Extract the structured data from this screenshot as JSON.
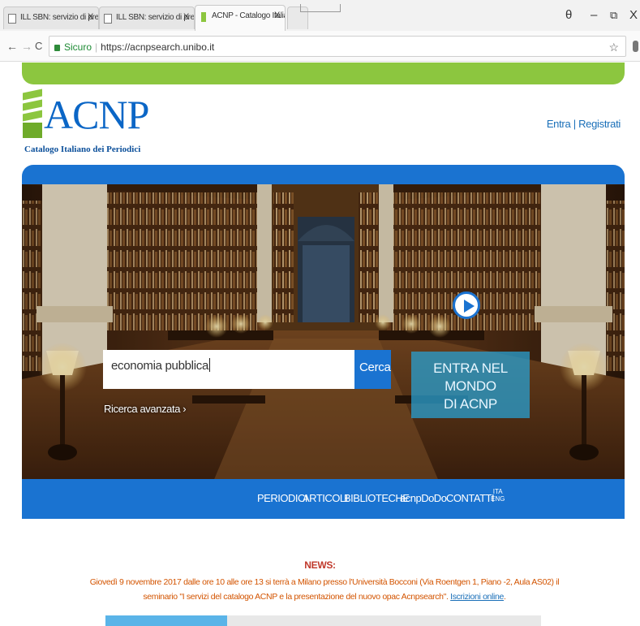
{
  "browser": {
    "tabs": [
      {
        "title": "ILL SBN: servizio di prest",
        "close": "X"
      },
      {
        "title": "ILL SBN: servizio di prest",
        "close": "X"
      },
      {
        "title": "ACNP - Catalogo Italiano",
        "close": "X"
      }
    ],
    "window_controls": {
      "user": "θ",
      "minimize": "–",
      "restore": "⧉",
      "close": "X"
    },
    "nav": {
      "back": "←",
      "forward": "→",
      "reload": "C"
    },
    "address": {
      "secure_label": "Sicuro",
      "url": "https://acnpsearch.unibo.it"
    },
    "bookmark_icon": "☆"
  },
  "header": {
    "logo_text": "ACNP",
    "logo_subtitle": "Catalogo Italiano dei Periodici",
    "login_link": "Entra | Registrati"
  },
  "search": {
    "query": "economia pubblica",
    "button_label": "Cerca",
    "advanced_link": "Ricerca avanzata ›"
  },
  "promo": {
    "line1": "ENTRA NEL MONDO",
    "line2": "DI ACNP"
  },
  "menu": {
    "items": [
      "PERIODICI",
      "ARTICOLI",
      "BIBLIOTECHE",
      "acnpDoDo",
      "CONTATTI"
    ],
    "lang_ita": "ITA",
    "lang_eng": "ENG"
  },
  "news": {
    "title": "NEWS:",
    "text": "Giovedì 9 novembre 2017 dalle ore 10 alle ore 13 si terrà a Milano presso l'Università Bocconi (Via Roentgen 1, Piano -2, Aula AS02) il seminario \"I servizi del catalogo ACNP e la presentazione del nuovo opac Acnpsearch\".",
    "link": "Iscrizioni online"
  },
  "colors": {
    "brand_blue": "#1a73d1",
    "brand_green": "#8cc63f",
    "news_red": "#c0392b"
  }
}
